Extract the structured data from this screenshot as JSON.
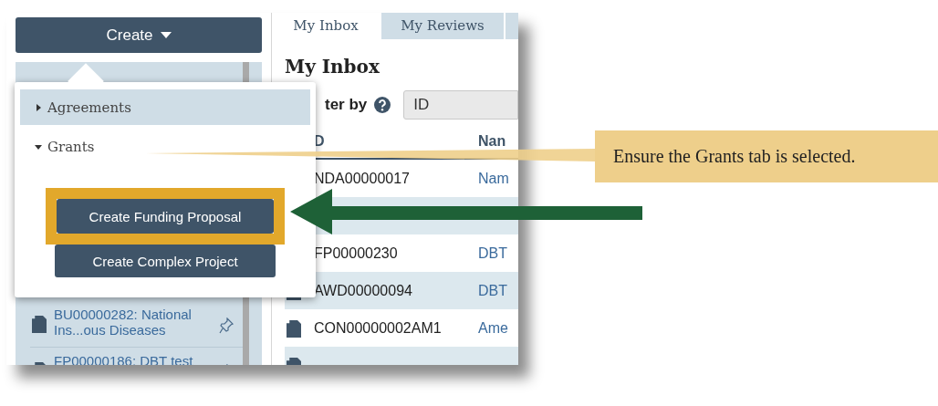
{
  "sidebar": {
    "create_button": {
      "label": "Create"
    },
    "items": [
      {
        "title": "BU00000282: National Ins...ous Diseases"
      },
      {
        "title": "FP00000186: DBT test"
      }
    ]
  },
  "tabs": [
    {
      "label": "My Inbox",
      "selected": true
    },
    {
      "label": "My Reviews",
      "selected": false
    },
    {
      "selected": false
    }
  ],
  "heading": "My Inbox",
  "filter": {
    "label": "ter by",
    "value": "ID"
  },
  "table": {
    "columns": [
      "D",
      "Nan"
    ],
    "rows": [
      {
        "kind": "partial",
        "id": "NDA00000017",
        "name": "Nam"
      },
      {
        "kind": "covered"
      },
      {
        "kind": "partial",
        "id": "FP00000230",
        "name": "DBT"
      },
      {
        "kind": "item",
        "id": "AWD00000094",
        "name": "DBT"
      },
      {
        "kind": "item",
        "id": "CON00000002AM1",
        "name": "Ame"
      },
      {
        "kind": "cut"
      }
    ]
  },
  "create_menu": {
    "sections": [
      {
        "label": "Agreements",
        "expanded": false,
        "highlighted": true
      },
      {
        "label": "Grants",
        "expanded": true,
        "highlighted": false,
        "buttons": [
          "Create Funding Proposal",
          "Create Complex Project"
        ]
      }
    ]
  },
  "callout": {
    "text": "Ensure the Grants tab is selected."
  }
}
